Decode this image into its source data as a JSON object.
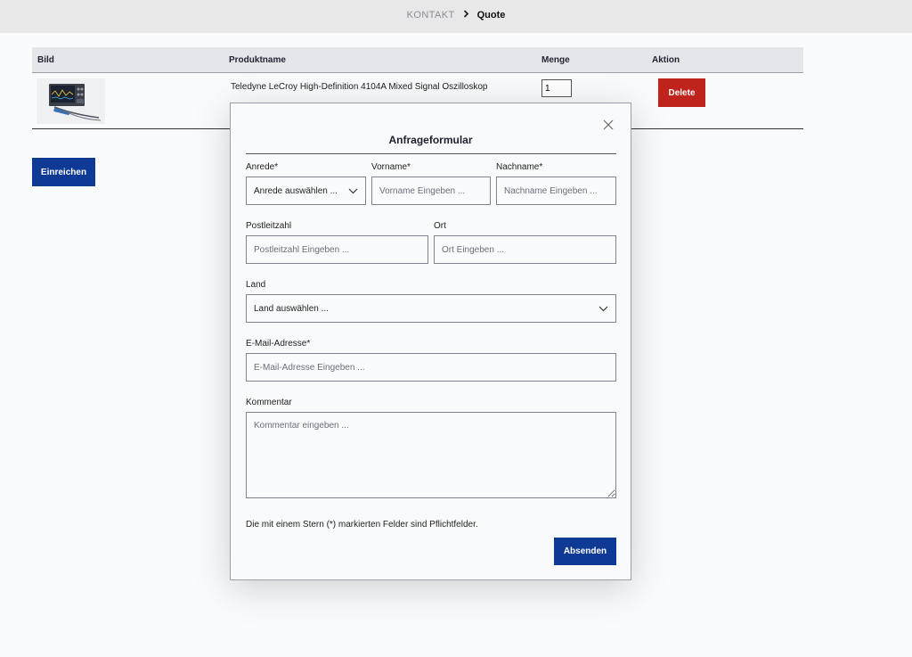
{
  "breadcrumb": {
    "parent": "KONTAKT",
    "separator": "›",
    "current": "Quote"
  },
  "table": {
    "headers": [
      "Bild",
      "Produktname",
      "Menge",
      "Aktion"
    ],
    "rows": [
      {
        "product_name": "Teledyne LeCroy High-Definition 4104A Mixed Signal Oszilloskop",
        "quantity": "1",
        "action_label": "Delete"
      }
    ]
  },
  "submit_label": "Einreichen",
  "modal": {
    "title": "Anfrageformular",
    "fields": {
      "salutation": {
        "label": "Anrede*",
        "value": "Anrede auswählen ..."
      },
      "first_name": {
        "label": "Vorname*",
        "placeholder": "Vorname Eingeben ..."
      },
      "last_name": {
        "label": "Nachname*",
        "placeholder": "Nachname Eingeben ..."
      },
      "postal_code": {
        "label": "Postleitzahl",
        "placeholder": "Postleitzahl Eingeben ..."
      },
      "city": {
        "label": "Ort",
        "placeholder": "Ort Eingeben ..."
      },
      "country": {
        "label": "Land",
        "value": "Land auswählen ..."
      },
      "email": {
        "label": "E-Mail-Adresse*",
        "placeholder": "E-Mail-Adresse Eingeben ..."
      },
      "comment": {
        "label": "Kommentar",
        "placeholder": "Kommentar eingeben ..."
      }
    },
    "required_note": "Die mit einem Stern (*) markierten Felder sind Pflichtfelder.",
    "send_label": "Absenden"
  },
  "colors": {
    "primary": "#0e3a96",
    "danger": "#c0221c"
  },
  "icons": [
    "chevron-right-icon",
    "close-icon",
    "chevron-down-icon",
    "oscilloscope-product-image"
  ]
}
